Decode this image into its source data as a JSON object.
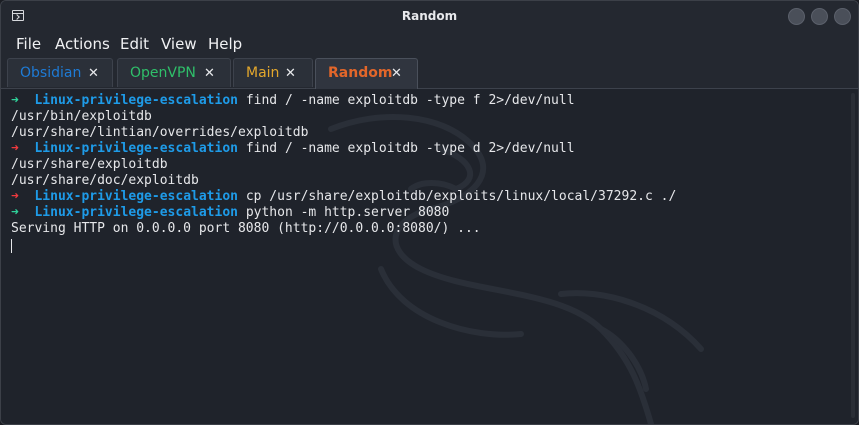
{
  "window": {
    "title": "Random"
  },
  "menu": [
    "File",
    "Actions",
    "Edit",
    "View",
    "Help"
  ],
  "tabs": [
    {
      "label": "Obsidian",
      "color": "#1e7bd6",
      "close": "✕"
    },
    {
      "label": "OpenVPN",
      "color": "#2fbf6a",
      "close": "✕"
    },
    {
      "label": "Main",
      "color": "#e3a72c",
      "close": "✕"
    },
    {
      "label": "Random",
      "color": "#e2662a",
      "close": "✕"
    }
  ],
  "terminal": {
    "prompt_arrow": "➜",
    "lines": [
      {
        "kind": "prompt",
        "status": "ok",
        "dir": "Linux-privilege-escalation",
        "cmd": "find / -name exploitdb -type f 2>/dev/null"
      },
      {
        "kind": "output",
        "text": "/usr/bin/exploitdb"
      },
      {
        "kind": "output",
        "text": "/usr/share/lintian/overrides/exploitdb"
      },
      {
        "kind": "prompt",
        "status": "err",
        "dir": "Linux-privilege-escalation",
        "cmd": "find / -name exploitdb -type d 2>/dev/null"
      },
      {
        "kind": "output",
        "text": "/usr/share/exploitdb"
      },
      {
        "kind": "output",
        "text": "/usr/share/doc/exploitdb"
      },
      {
        "kind": "prompt",
        "status": "err",
        "dir": "Linux-privilege-escalation",
        "cmd": "cp /usr/share/exploitdb/exploits/linux/local/37292.c ./"
      },
      {
        "kind": "prompt",
        "status": "ok",
        "dir": "Linux-privilege-escalation",
        "cmd": "python -m http.server 8080"
      },
      {
        "kind": "output",
        "text": "Serving HTTP on 0.0.0.0 port 8080 (http://0.0.0.0:8080/) ..."
      }
    ]
  },
  "icons": {
    "app": "terminal-icon",
    "window_buttons": [
      "minimize-button",
      "maximize-button",
      "close-button"
    ],
    "background": "kali-dragon-watermark"
  }
}
